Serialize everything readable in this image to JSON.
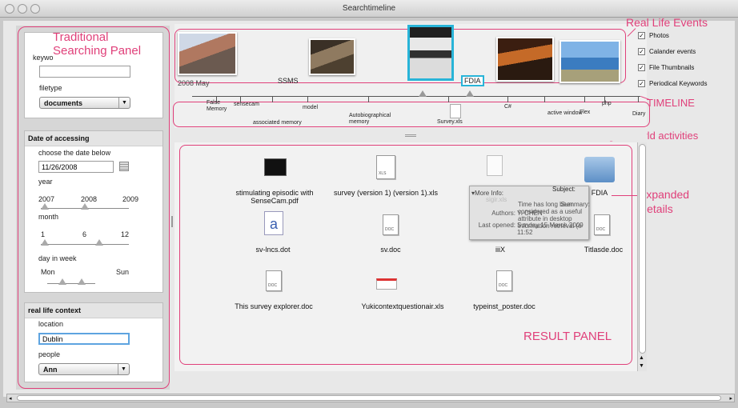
{
  "window": {
    "title": "Searchtimeline"
  },
  "annotations": {
    "traditional_panel": "Traditional Searching Panel",
    "real_life_events": "Real Life Events",
    "timeline": "TIMELINE",
    "digital_world": "Digital world activities",
    "expanded_details": "Expanded Details",
    "result_panel": "RESULT PANEL"
  },
  "search": {
    "keyword_label": "keywo",
    "keyword_value": "",
    "filetype_label": "filetype",
    "filetype_value": "documents"
  },
  "date": {
    "header": "Date of accessing",
    "choose_label": "choose the date below",
    "date_value": "11/26/2008",
    "year_label": "year",
    "year_ticks": [
      "2007",
      "2008",
      "2009"
    ],
    "month_label": "month",
    "month_ticks": [
      "1",
      "6",
      "12"
    ],
    "week_label": "day in week",
    "week_ticks": [
      "Mon",
      "Sun"
    ]
  },
  "context": {
    "header": "real life context",
    "location_label": "location",
    "location_value": "Dublin",
    "people_label": "people",
    "people_value": "Ann"
  },
  "timeline": {
    "start_label": "2008 May",
    "ssms_label": "SSMS",
    "fdia_label": "FDIA",
    "words": [
      {
        "text": "False Memory"
      },
      {
        "text": "sensecam"
      },
      {
        "text": "associated memory"
      },
      {
        "text": "model"
      },
      {
        "text": "Autobiographical memory"
      },
      {
        "text": "Survey.xls"
      },
      {
        "text": "C#"
      },
      {
        "text": "active window"
      },
      {
        "text": "Flex"
      },
      {
        "text": "php"
      },
      {
        "text": "Diary"
      }
    ]
  },
  "options": [
    {
      "label": "Photos",
      "checked": true
    },
    {
      "label": "Calander events",
      "checked": true
    },
    {
      "label": "File Thumbnails",
      "checked": true
    },
    {
      "label": "Periodical Keywords",
      "checked": true
    }
  ],
  "results": [
    {
      "name": "stimulating episodic with SenseCam.pdf",
      "icon": "pdf-thumbnail-icon"
    },
    {
      "name": "survey (version 1) (version 1).xls",
      "icon": "xls-file-icon"
    },
    {
      "name": "FDIA",
      "icon": "folder-icon"
    },
    {
      "name": "sv-lncs.dot",
      "icon": "dot-file-icon"
    },
    {
      "name": "sv.doc",
      "icon": "doc-file-icon"
    },
    {
      "name": "iiiX",
      "icon": "doc-file-icon"
    },
    {
      "name": "Titlasde.doc",
      "icon": "doc-file-icon"
    },
    {
      "name": "This survey explorer.doc",
      "icon": "doc-file-icon"
    },
    {
      "name": "Yukicontextquestionair.xls",
      "icon": "xls-file-icon"
    },
    {
      "name": "typeinst_poster.doc",
      "icon": "doc-file-icon"
    }
  ],
  "popup": {
    "more_info": "More Info:",
    "subject_label": "Subject:",
    "faded_filename": "sigir.xls",
    "summary_label": "Summary:",
    "summary_value": "Time has long been considered as a useful attribute in desktop information retrieval (e",
    "authors_label": "Authors:",
    "authors_value": "Yi CHEN",
    "last_opened_label": "Last opened:",
    "last_opened_value": "Sunday 15 March 2009 11:52"
  },
  "doc_tags": {
    "doc": "DOC",
    "xls": "XLS"
  },
  "colors": {
    "annotation": "#e0407a",
    "selection": "#28b4d8"
  }
}
